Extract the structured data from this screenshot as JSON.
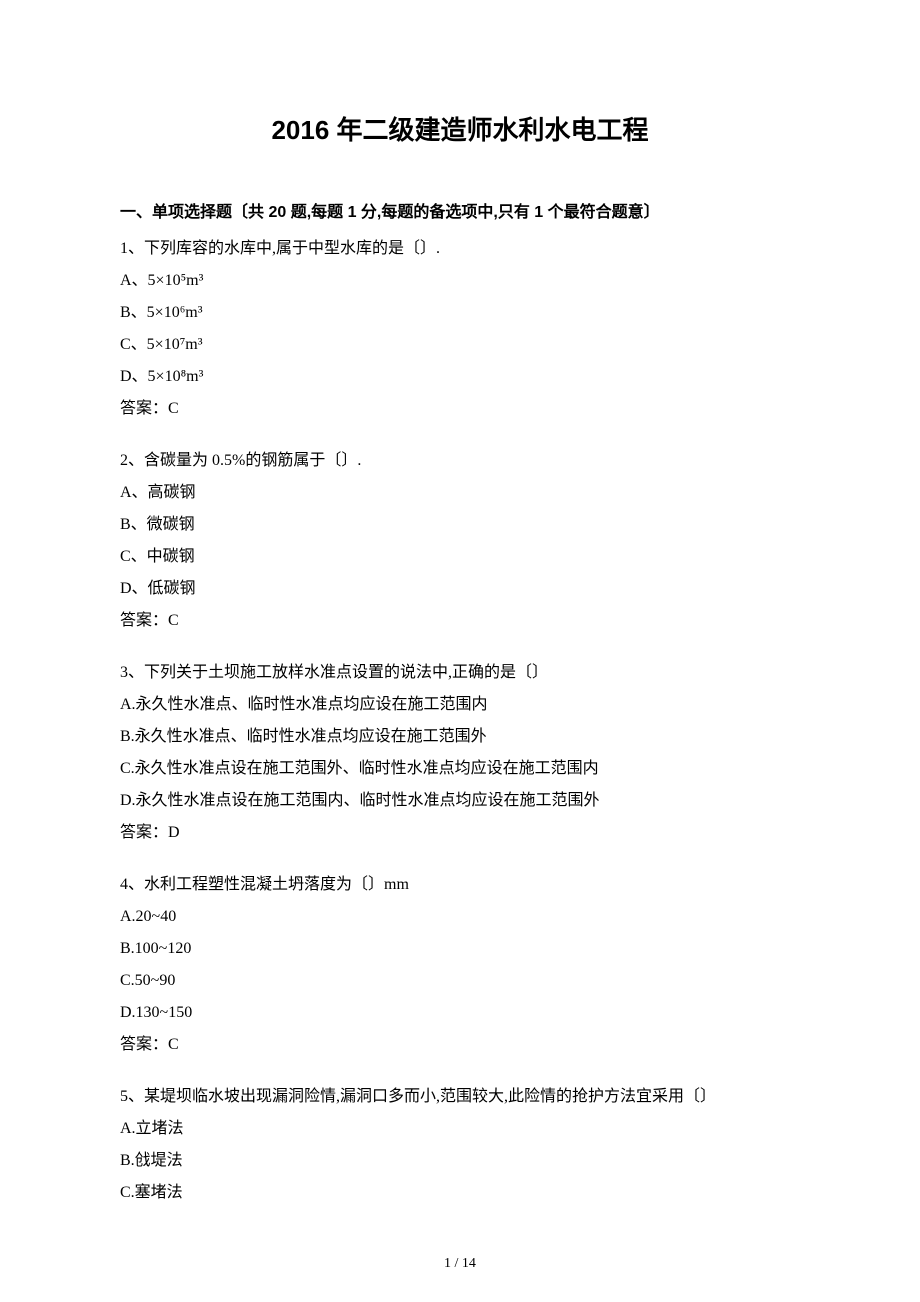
{
  "title": "2016 年二级建造师水利水电工程",
  "section_header": "一、单项选择题〔共 20 题,每题 1 分,每题的备选项中,只有 1 个最符合题意〕",
  "q1": {
    "stem": "1、下列库容的水库中,属于中型水库的是〔〕.",
    "a": "A、5×10⁵m³",
    "b": "B、5×10⁶m³",
    "c": "C、5×10⁷m³",
    "d": "D、5×10⁸m³",
    "ans": "答案：C"
  },
  "q2": {
    "stem": "2、含碳量为 0.5%的钢筋属于〔〕.",
    "a": "A、高碳钢",
    "b": "B、微碳钢",
    "c": "C、中碳钢",
    "d": "D、低碳钢",
    "ans": "答案：C"
  },
  "q3": {
    "stem": "3、下列关于土坝施工放样水准点设置的说法中,正确的是〔〕",
    "a": "A.永久性水准点、临时性水准点均应设在施工范围内",
    "b": "B.永久性水准点、临时性水准点均应设在施工范围外",
    "c": "C.永久性水准点设在施工范围外、临时性水准点均应设在施工范围内",
    "d": "D.永久性水准点设在施工范围内、临时性水准点均应设在施工范围外",
    "ans": "答案：D"
  },
  "q4": {
    "stem": "4、水利工程塑性混凝土坍落度为〔〕mm",
    "a": "A.20~40",
    "b": "B.100~120",
    "c": "C.50~90",
    "d": "D.130~150",
    "ans": "答案：C"
  },
  "q5": {
    "stem": "5、某堤坝临水坡出现漏洞险情,漏洞口多而小,范围较大,此险情的抢护方法宜采用〔〕",
    "a": "A.立堵法",
    "b": "B.戗堤法",
    "c": "C.塞堵法"
  },
  "page_number": "1 / 14"
}
